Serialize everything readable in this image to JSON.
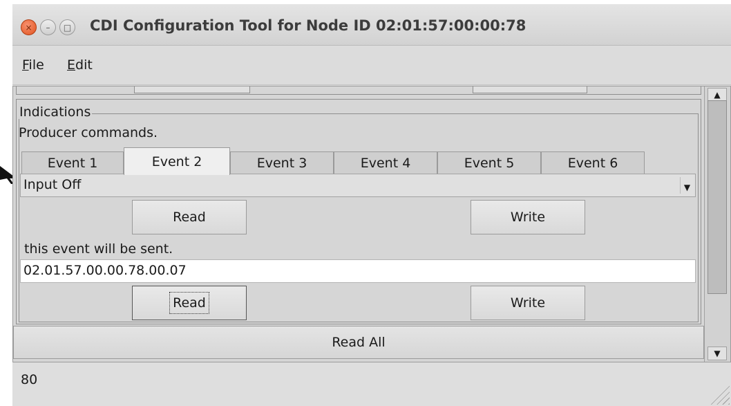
{
  "window": {
    "title": "CDI Configuration Tool for Node ID 02:01:57:00:00:78",
    "close_symbol": "×",
    "min_symbol": "–",
    "max_symbol": "□"
  },
  "menu": [
    {
      "label_underlined": "F",
      "label_rest": "ile"
    },
    {
      "label_underlined": "E",
      "label_rest": "dit"
    }
  ],
  "group": {
    "title": "Indications",
    "description": "Producer commands."
  },
  "tabs": [
    {
      "label": "Event 1",
      "active": false
    },
    {
      "label": "Event 2",
      "active": true
    },
    {
      "label": "Event 3",
      "active": false
    },
    {
      "label": "Event 4",
      "active": false
    },
    {
      "label": "Event 5",
      "active": false
    },
    {
      "label": "Event 6",
      "active": false
    }
  ],
  "event": {
    "action_selected": "Input Off",
    "read_label": "Read",
    "write_label": "Write",
    "hint": "this event will be sent.",
    "event_id": "02.01.57.00.00.78.00.07"
  },
  "read_all_label": "Read All",
  "status_text": "80",
  "colors": {
    "close_button": "#e1541f",
    "window_bg": "#dedede",
    "field_bg": "#ffffff"
  }
}
